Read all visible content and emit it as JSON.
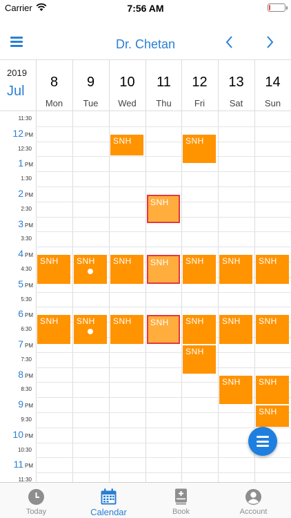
{
  "status_bar": {
    "carrier": "Carrier",
    "time": "7:56 AM",
    "battery_level": 0.1,
    "battery_color": "#e74c3c"
  },
  "header": {
    "title": "Dr. Chetan",
    "accent_color": "#2a7fd4"
  },
  "calendar": {
    "year": "2019",
    "month": "Jul",
    "days": [
      {
        "num": "8",
        "name": "Mon"
      },
      {
        "num": "9",
        "name": "Tue"
      },
      {
        "num": "10",
        "name": "Wed"
      },
      {
        "num": "11",
        "name": "Thu"
      },
      {
        "num": "12",
        "name": "Fri"
      },
      {
        "num": "13",
        "name": "Sat"
      },
      {
        "num": "14",
        "name": "Sun"
      }
    ],
    "times": [
      {
        "label": "11:30",
        "major": false
      },
      {
        "label": "12",
        "suffix": "PM",
        "major": true
      },
      {
        "label": "12:30",
        "major": false
      },
      {
        "label": "1",
        "suffix": "PM",
        "major": true
      },
      {
        "label": "1:30",
        "major": false
      },
      {
        "label": "2",
        "suffix": "PM",
        "major": true
      },
      {
        "label": "2:30",
        "major": false
      },
      {
        "label": "3",
        "suffix": "PM",
        "major": true
      },
      {
        "label": "3:30",
        "major": false
      },
      {
        "label": "4",
        "suffix": "PM",
        "major": true
      },
      {
        "label": "4:30",
        "major": false
      },
      {
        "label": "5",
        "suffix": "PM",
        "major": true
      },
      {
        "label": "5:30",
        "major": false
      },
      {
        "label": "6",
        "suffix": "PM",
        "major": true
      },
      {
        "label": "6:30",
        "major": false
      },
      {
        "label": "7",
        "suffix": "PM",
        "major": true
      },
      {
        "label": "7:30",
        "major": false
      },
      {
        "label": "8",
        "suffix": "PM",
        "major": true
      },
      {
        "label": "8:30",
        "major": false
      },
      {
        "label": "9",
        "suffix": "PM",
        "major": true
      },
      {
        "label": "9:30",
        "major": false
      },
      {
        "label": "10",
        "suffix": "PM",
        "major": true
      },
      {
        "label": "10:30",
        "major": false
      },
      {
        "label": "11",
        "suffix": "PM",
        "major": true
      },
      {
        "label": "11:30",
        "major": false
      }
    ],
    "event_color": "#ff9300",
    "selected_color": "#ffad3d",
    "selected_border": "#e4383c",
    "events": [
      {
        "day": 2,
        "start": "12:00",
        "end": "12:45",
        "label": "SNH"
      },
      {
        "day": 4,
        "start": "12:00",
        "end": "13:00",
        "label": "SNH"
      },
      {
        "day": 3,
        "start": "14:00",
        "end": "15:00",
        "label": "SNH",
        "selected": true
      },
      {
        "day": 0,
        "start": "16:00",
        "end": "17:00",
        "label": "SNH"
      },
      {
        "day": 1,
        "start": "16:00",
        "end": "17:00",
        "label": "SNH",
        "dot": true
      },
      {
        "day": 2,
        "start": "16:00",
        "end": "17:00",
        "label": "SNH"
      },
      {
        "day": 3,
        "start": "16:00",
        "end": "17:00",
        "label": "SNH",
        "selected": true
      },
      {
        "day": 4,
        "start": "16:00",
        "end": "17:00",
        "label": "SNH"
      },
      {
        "day": 5,
        "start": "16:00",
        "end": "17:00",
        "label": "SNH"
      },
      {
        "day": 6,
        "start": "16:00",
        "end": "17:00",
        "label": "SNH"
      },
      {
        "day": 0,
        "start": "18:00",
        "end": "19:00",
        "label": "SNH"
      },
      {
        "day": 1,
        "start": "18:00",
        "end": "19:00",
        "label": "SNH",
        "dot": true
      },
      {
        "day": 2,
        "start": "18:00",
        "end": "19:00",
        "label": "SNH"
      },
      {
        "day": 3,
        "start": "18:00",
        "end": "19:00",
        "label": "SNH",
        "selected": true
      },
      {
        "day": 4,
        "start": "18:00",
        "end": "19:00",
        "label": "SNH"
      },
      {
        "day": 5,
        "start": "18:00",
        "end": "19:00",
        "label": "SNH"
      },
      {
        "day": 6,
        "start": "18:00",
        "end": "19:00",
        "label": "SNH"
      },
      {
        "day": 4,
        "start": "19:00",
        "end": "20:00",
        "label": "SNH"
      },
      {
        "day": 5,
        "start": "20:00",
        "end": "21:00",
        "label": "SNH"
      },
      {
        "day": 6,
        "start": "20:00",
        "end": "21:00",
        "label": "SNH"
      },
      {
        "day": 6,
        "start": "21:00",
        "end": "21:45",
        "label": "SNH"
      }
    ]
  },
  "tabbar": {
    "tabs": [
      {
        "label": "Today",
        "icon": "clock-icon",
        "active": false
      },
      {
        "label": "Calendar",
        "icon": "calendar-icon",
        "active": true
      },
      {
        "label": "Book",
        "icon": "book-icon",
        "active": false
      },
      {
        "label": "Account",
        "icon": "account-icon",
        "active": false
      }
    ]
  }
}
